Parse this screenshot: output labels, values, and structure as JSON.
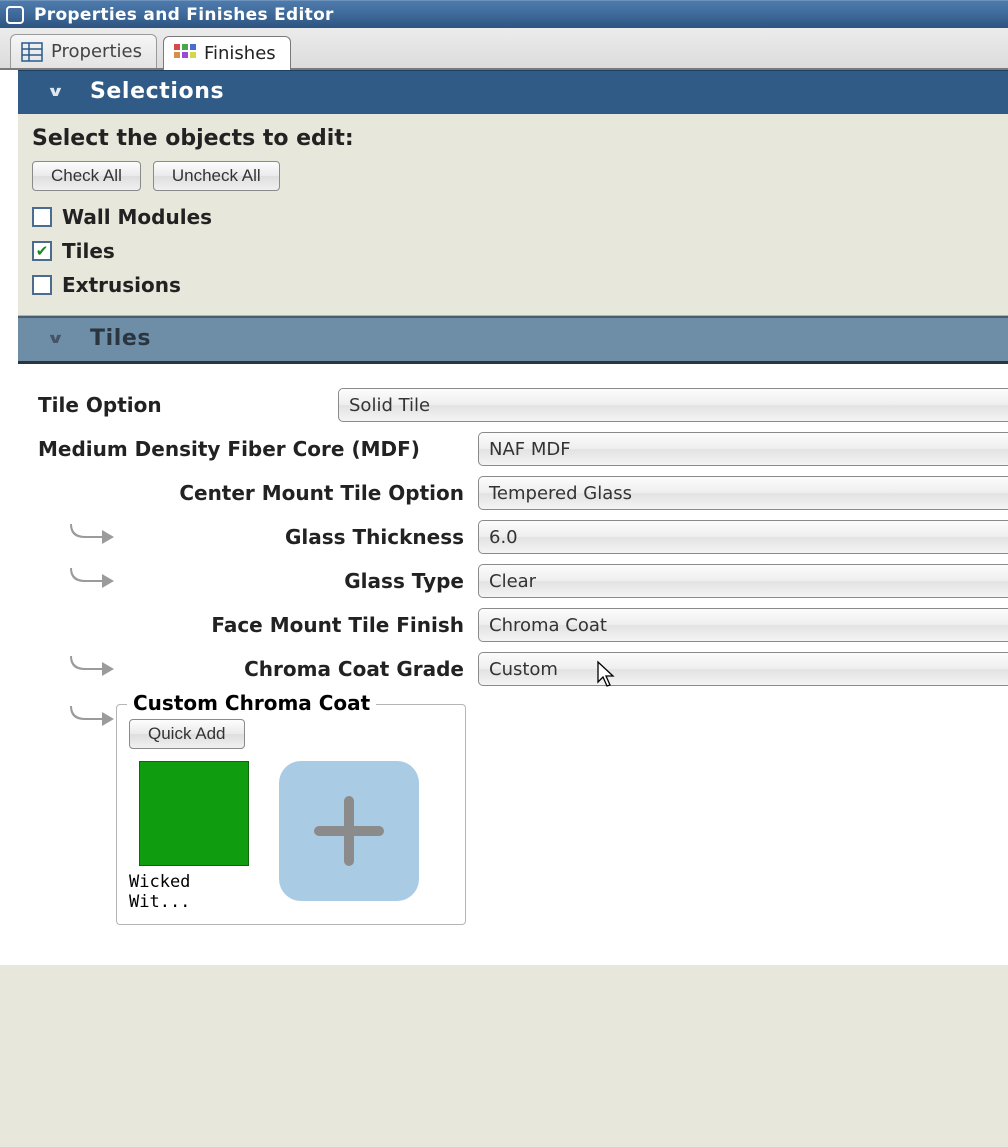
{
  "window": {
    "title": "Properties and Finishes Editor"
  },
  "tabs": [
    {
      "label": "Properties",
      "active": false
    },
    {
      "label": "Finishes",
      "active": true
    }
  ],
  "selections": {
    "header": "Selections",
    "prompt": "Select the objects to edit:",
    "check_all": "Check All",
    "uncheck_all": "Uncheck All",
    "items": [
      {
        "label": "Wall Modules",
        "checked": false
      },
      {
        "label": "Tiles",
        "checked": true
      },
      {
        "label": "Extrusions",
        "checked": false
      }
    ]
  },
  "tiles": {
    "header": "Tiles",
    "rows": {
      "tile_option": {
        "label": "Tile Option",
        "value": "Solid Tile"
      },
      "mdf": {
        "label": "Medium Density Fiber Core (MDF)",
        "value": "NAF MDF"
      },
      "center_mount": {
        "label": "Center Mount Tile Option",
        "value": "Tempered Glass"
      },
      "glass_thickness": {
        "label": "Glass Thickness",
        "value": "6.0"
      },
      "glass_type": {
        "label": "Glass Type",
        "value": "Clear"
      },
      "face_mount_finish": {
        "label": "Face Mount Tile Finish",
        "value": "Chroma Coat"
      },
      "chroma_grade": {
        "label": "Chroma Coat Grade",
        "value": "Custom"
      }
    },
    "custom_group": {
      "legend": "Custom Chroma Coat",
      "quick_add": "Quick Add",
      "swatches": [
        {
          "name": "Wicked Wit...",
          "color": "#0f9d0f"
        }
      ]
    }
  },
  "icons": {
    "colors_grid": [
      "#d64a4a",
      "#4aa64a",
      "#4a6cd6",
      "#d68f4a",
      "#9a4ad6",
      "#d6d64a"
    ]
  }
}
